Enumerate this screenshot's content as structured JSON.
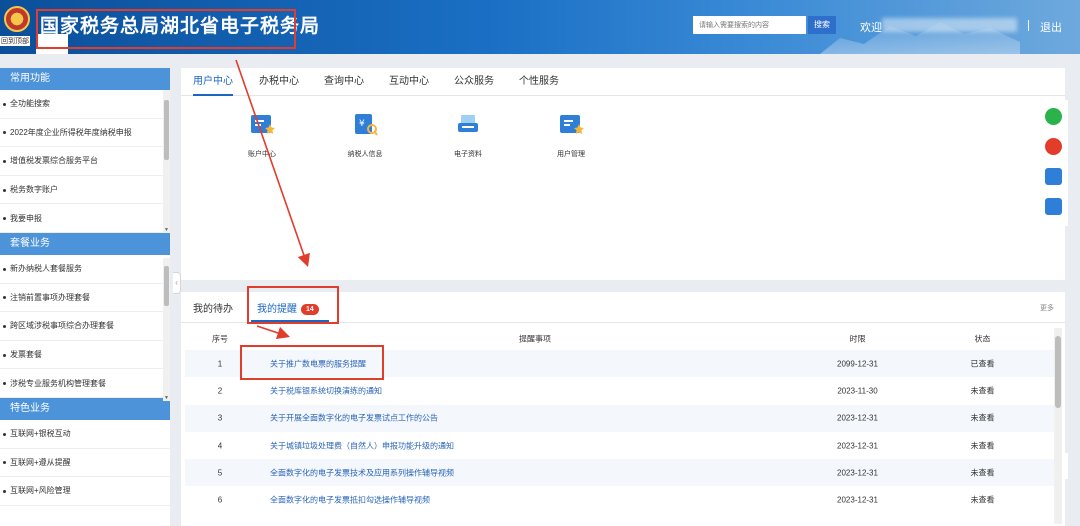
{
  "header": {
    "emblem_label": "回到顶部",
    "site_title": "国家税务总局湖北省电子税务局",
    "search_placeholder": "请输入需要搜索的内容",
    "search_button": "搜索",
    "welcome": "欢迎",
    "logout": "退出",
    "colors": {
      "title_box": "#e23c2a",
      "header_blue": "#1a6fc4"
    }
  },
  "sidebar": {
    "sections": [
      {
        "title": "常用功能",
        "items": [
          "全功能搜索",
          "2022年度企业所得税年度纳税申报",
          "增值税发票综合服务平台",
          "税务数字账户",
          "我要申报"
        ]
      },
      {
        "title": "套餐业务",
        "items": [
          "新办纳税人套餐服务",
          "注销前置事项办理套餐",
          "跨区域涉税事项综合办理套餐",
          "发票套餐",
          "涉税专业服务机构管理套餐"
        ]
      },
      {
        "title": "特色业务",
        "items": [
          "互联网+银税互动",
          "互联网+遵从提醒",
          "互联网+风险管理"
        ]
      }
    ]
  },
  "main_tabs": [
    "用户中心",
    "办税中心",
    "查询中心",
    "互动中心",
    "公众服务",
    "个性服务"
  ],
  "services": [
    {
      "label": "账户中心",
      "icon": "account-center-icon"
    },
    {
      "label": "纳税人信息",
      "icon": "taxpayer-info-icon"
    },
    {
      "label": "电子资料",
      "icon": "electronic-data-icon"
    },
    {
      "label": "用户管理",
      "icon": "user-management-icon"
    }
  ],
  "float_icons": [
    "wechat-icon",
    "weibo-icon",
    "app-icon",
    "app-icon",
    "feedback-icon"
  ],
  "reminders": {
    "tabs": {
      "todo": "我的待办",
      "remind": "我的提醒",
      "badge": "14"
    },
    "more": "更多",
    "headers": {
      "no": "序号",
      "title": "提醒事项",
      "date": "时限",
      "status": "状态"
    },
    "rows": [
      {
        "no": "1",
        "title": "关于推广数电票的服务提醒",
        "date": "2099-12-31",
        "status": "已查看"
      },
      {
        "no": "2",
        "title": "关于税库银系统切换演练的通知",
        "date": "2023-11-30",
        "status": "未查看"
      },
      {
        "no": "3",
        "title": "关于开展全面数字化的电子发票试点工作的公告",
        "date": "2023-12-31",
        "status": "未查看"
      },
      {
        "no": "4",
        "title": "关于城镇垃圾处理费（自然人）申报功能升级的通知",
        "date": "2023-12-31",
        "status": "未查看"
      },
      {
        "no": "5",
        "title": "全面数字化的电子发票技术及应用系列操作辅导视频",
        "date": "2023-12-31",
        "status": "未查看"
      },
      {
        "no": "6",
        "title": "全面数字化的电子发票抵扣勾选操作辅导视频",
        "date": "2023-12-31",
        "status": "未查看"
      }
    ]
  }
}
